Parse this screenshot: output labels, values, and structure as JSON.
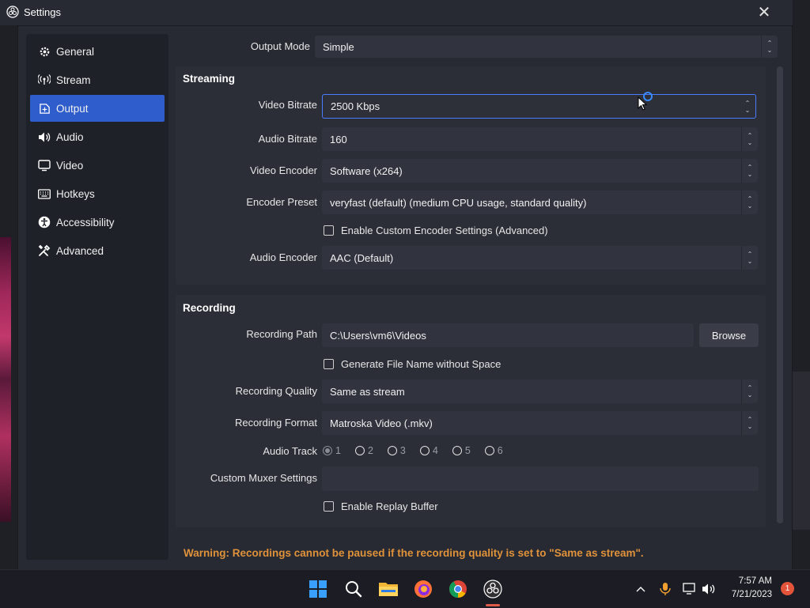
{
  "window": {
    "title": "Settings"
  },
  "sidebar": {
    "items": [
      {
        "label": "General",
        "icon": "gear-icon"
      },
      {
        "label": "Stream",
        "icon": "antenna-icon"
      },
      {
        "label": "Output",
        "icon": "output-icon",
        "active": true
      },
      {
        "label": "Audio",
        "icon": "speaker-icon"
      },
      {
        "label": "Video",
        "icon": "monitor-icon"
      },
      {
        "label": "Hotkeys",
        "icon": "keyboard-icon"
      },
      {
        "label": "Accessibility",
        "icon": "accessibility-icon"
      },
      {
        "label": "Advanced",
        "icon": "tools-icon"
      }
    ]
  },
  "output_mode": {
    "label": "Output Mode",
    "value": "Simple"
  },
  "streaming": {
    "title": "Streaming",
    "video_bitrate": {
      "label": "Video Bitrate",
      "value": "2500 Kbps"
    },
    "audio_bitrate": {
      "label": "Audio Bitrate",
      "value": "160"
    },
    "video_encoder": {
      "label": "Video Encoder",
      "value": "Software (x264)"
    },
    "encoder_preset": {
      "label": "Encoder Preset",
      "value": "veryfast (default) (medium CPU usage, standard quality)"
    },
    "custom_encoder": {
      "label": "Enable Custom Encoder Settings (Advanced)",
      "checked": false
    },
    "audio_encoder": {
      "label": "Audio Encoder",
      "value": "AAC (Default)"
    }
  },
  "recording": {
    "title": "Recording",
    "path": {
      "label": "Recording Path",
      "value": "C:\\Users\\vm6\\Videos",
      "browse": "Browse"
    },
    "no_space": {
      "label": "Generate File Name without Space",
      "checked": false
    },
    "quality": {
      "label": "Recording Quality",
      "value": "Same as stream"
    },
    "format": {
      "label": "Recording Format",
      "value": "Matroska Video (.mkv)"
    },
    "audio_track": {
      "label": "Audio Track",
      "tracks": [
        "1",
        "2",
        "3",
        "4",
        "5",
        "6"
      ],
      "selected": "1"
    },
    "muxer": {
      "label": "Custom Muxer Settings",
      "value": ""
    },
    "replay": {
      "label": "Enable Replay Buffer",
      "checked": false
    }
  },
  "warning": "Warning: Recordings cannot be paused if the recording quality is set to \"Same as stream\".",
  "taskbar": {
    "time": "7:57 AM",
    "date": "7/21/2023",
    "notifications": "1"
  },
  "colors": {
    "accent": "#2f5ecc",
    "warning": "#e0923a",
    "focus": "#4a7cff"
  }
}
